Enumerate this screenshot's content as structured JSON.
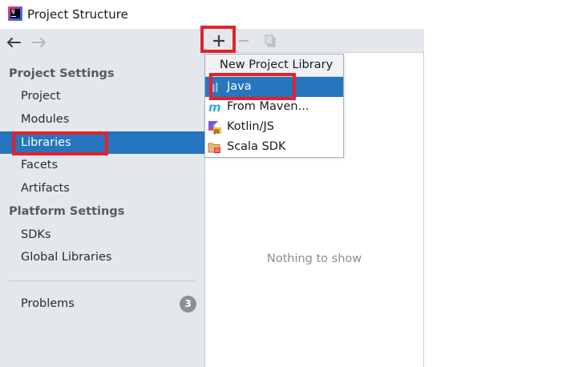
{
  "window": {
    "title": "Project Structure",
    "app_icon": "intellij-idea-icon"
  },
  "nav": {
    "back_icon": "arrow-left-icon",
    "forward_icon": "arrow-right-icon"
  },
  "sidebar": {
    "project_settings_header": "Project Settings",
    "project_items": [
      {
        "label": "Project"
      },
      {
        "label": "Modules"
      },
      {
        "label": "Libraries",
        "selected": true
      },
      {
        "label": "Facets"
      },
      {
        "label": "Artifacts"
      }
    ],
    "platform_settings_header": "Platform Settings",
    "platform_items": [
      {
        "label": "SDKs"
      },
      {
        "label": "Global Libraries"
      }
    ],
    "problems": {
      "label": "Problems",
      "count": "3"
    }
  },
  "toolbar": {
    "add_icon": "plus-icon",
    "remove_icon": "minus-icon",
    "copy_icon": "copy-icon"
  },
  "middle": {
    "empty_text": "Nothing to show"
  },
  "popup": {
    "header": "New Project Library",
    "items": [
      {
        "label": "Java",
        "icon": "java-library-icon",
        "selected": true
      },
      {
        "label": "From Maven...",
        "icon": "maven-icon"
      },
      {
        "label": "Kotlin/JS",
        "icon": "kotlin-js-icon"
      },
      {
        "label": "Scala SDK",
        "icon": "scala-sdk-icon"
      }
    ]
  },
  "colors": {
    "selection": "#2675bf",
    "sidebar_bg": "#e4e8ed",
    "highlight": "#e8202a"
  }
}
